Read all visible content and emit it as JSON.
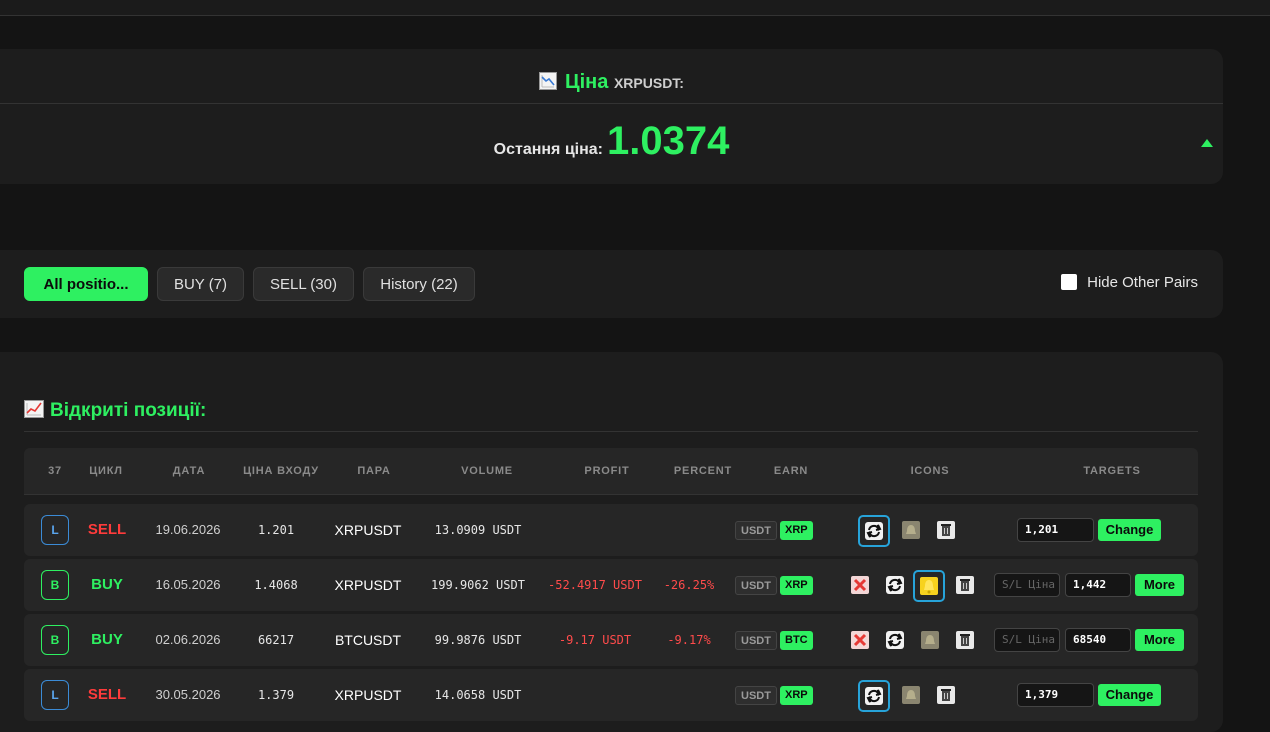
{
  "price": {
    "label": "Ціна",
    "pair": "XRPUSDT:",
    "last_label": "Остання ціна:",
    "last_value": "1.0374",
    "trend": "up"
  },
  "filters": {
    "tabs": [
      {
        "label": "All positio...",
        "active": true
      },
      {
        "label": "BUY (7)",
        "active": false
      },
      {
        "label": "SELL (30)",
        "active": false
      },
      {
        "label": "History (22)",
        "active": false
      }
    ],
    "hide_other_pairs": {
      "label": "Hide Other Pairs",
      "checked": false
    }
  },
  "positions": {
    "title": "Відкриті позиції:",
    "columns": [
      "37",
      "ЦИКЛ",
      "ДАТА",
      "ЦІНА ВХОДУ",
      "ПАРА",
      "VOLUME",
      "PROFIT",
      "PERCENT",
      "EARN",
      "ICONS",
      "TARGETS"
    ],
    "rows": [
      {
        "badge": "L",
        "side": "SELL",
        "date": "19.06.2026",
        "entry": "1.201",
        "pair": "XRPUSDT",
        "volume": "13.0909 USDT",
        "profit": "",
        "percent": "",
        "earn": [
          "USDT",
          "XRP"
        ],
        "icons": [
          "swap-icon",
          "bell-icon",
          "trash-icon"
        ],
        "target_placeholder": "",
        "target_value": "1,201",
        "action": "Change"
      },
      {
        "badge": "B",
        "side": "BUY",
        "date": "16.05.2026",
        "entry": "1.4068",
        "pair": "XRPUSDT",
        "volume": "199.9062 USDT",
        "profit": "-52.4917 USDT",
        "percent": "-26.25%",
        "earn": [
          "USDT",
          "XRP"
        ],
        "icons": [
          "close-icon",
          "swap-icon",
          "bell-icon",
          "trash-icon"
        ],
        "target_placeholder": "S/L Ціна",
        "target_value": "1,442",
        "action": "More"
      },
      {
        "badge": "B",
        "side": "BUY",
        "date": "02.06.2026",
        "entry": "66217",
        "pair": "BTCUSDT",
        "volume": "99.9876 USDT",
        "profit": "-9.17 USDT",
        "percent": "-9.17%",
        "earn": [
          "USDT",
          "BTC"
        ],
        "icons": [
          "close-icon",
          "swap-icon",
          "bell-icon",
          "trash-icon"
        ],
        "target_placeholder": "S/L Ціна",
        "target_value": "68540",
        "action": "More"
      },
      {
        "badge": "L",
        "side": "SELL",
        "date": "30.05.2026",
        "entry": "1.379",
        "pair": "XRPUSDT",
        "volume": "14.0658 USDT",
        "profit": "",
        "percent": "",
        "earn": [
          "USDT",
          "XRP"
        ],
        "icons": [
          "swap-icon",
          "bell-icon",
          "trash-icon"
        ],
        "target_placeholder": "",
        "target_value": "1,379",
        "action": "Change"
      }
    ]
  },
  "colors": {
    "accent": "#2ef061",
    "loss": "#ff4b4b",
    "long": "#3b8bd6",
    "highlight": "#27a3d9"
  }
}
